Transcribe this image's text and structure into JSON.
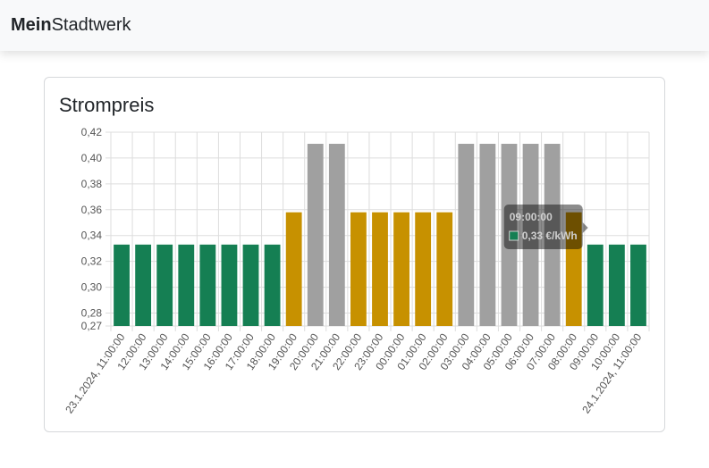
{
  "navbar": {
    "brand_bold": "Mein",
    "brand_rest": "Stadtwerk"
  },
  "card": {
    "title": "Strompreis"
  },
  "colors": {
    "green": "#157f53",
    "yellow": "#c79100",
    "gray": "#a0a0a0",
    "grid": "#dddddd"
  },
  "chart_data": {
    "type": "bar",
    "title": "Strompreis",
    "xlabel": "",
    "ylabel": "",
    "ylim": [
      0.27,
      0.42
    ],
    "yticks": [
      "0,42",
      "0,40",
      "0,38",
      "0,36",
      "0,34",
      "0,32",
      "0,30",
      "0,28",
      "0,27"
    ],
    "ytick_values": [
      0.42,
      0.4,
      0.38,
      0.36,
      0.34,
      0.32,
      0.3,
      0.28,
      0.27
    ],
    "grid": true,
    "categories": [
      "23.1.2024, 11:00:00",
      "12:00:00",
      "13:00:00",
      "14:00:00",
      "15:00:00",
      "16:00:00",
      "17:00:00",
      "18:00:00",
      "19:00:00",
      "20:00:00",
      "21:00:00",
      "22:00:00",
      "23:00:00",
      "00:00:00",
      "01:00:00",
      "02:00:00",
      "03:00:00",
      "04:00:00",
      "05:00:00",
      "06:00:00",
      "07:00:00",
      "08:00:00",
      "09:00:00",
      "10:00:00",
      "24.1.2024, 11:00:00"
    ],
    "values": [
      0.333,
      0.333,
      0.333,
      0.333,
      0.333,
      0.333,
      0.333,
      0.333,
      0.358,
      0.411,
      0.411,
      0.358,
      0.358,
      0.358,
      0.358,
      0.358,
      0.411,
      0.411,
      0.411,
      0.411,
      0.411,
      0.358,
      0.333,
      0.333,
      0.333
    ],
    "bar_colors": [
      "green",
      "green",
      "green",
      "green",
      "green",
      "green",
      "green",
      "green",
      "yellow",
      "gray",
      "gray",
      "yellow",
      "yellow",
      "yellow",
      "yellow",
      "yellow",
      "gray",
      "gray",
      "gray",
      "gray",
      "gray",
      "yellow",
      "green",
      "green",
      "green"
    ],
    "tooltip": {
      "title": "09:00:00",
      "value": "0,33 €/kWh",
      "bar_index": 21
    }
  }
}
